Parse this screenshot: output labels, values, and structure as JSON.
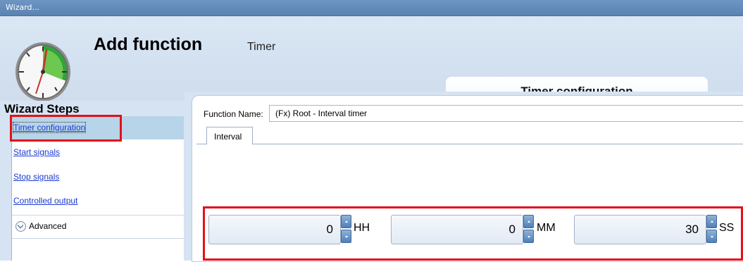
{
  "window": {
    "title": "Wizard..."
  },
  "header": {
    "title": "Add function",
    "subtitle": "Timer",
    "section_title": "Timer configuration"
  },
  "sidebar": {
    "title": "Wizard Steps",
    "items": [
      {
        "label": "Timer configuration",
        "active": true
      },
      {
        "label": "Start signals"
      },
      {
        "label": "Stop signals"
      },
      {
        "label": "Controlled output"
      }
    ],
    "advanced_label": "Advanced"
  },
  "form": {
    "function_name_label": "Function Name:",
    "function_name_value": "(Fx) Root - Interval timer",
    "tab_label": "Interval",
    "hours": {
      "value": "0",
      "unit": "HH"
    },
    "minutes": {
      "value": "0",
      "unit": "MM"
    },
    "seconds": {
      "value": "30",
      "unit": "SS"
    }
  },
  "colors": {
    "highlight_box": "#e3101a",
    "accent": "#5b83b2"
  }
}
